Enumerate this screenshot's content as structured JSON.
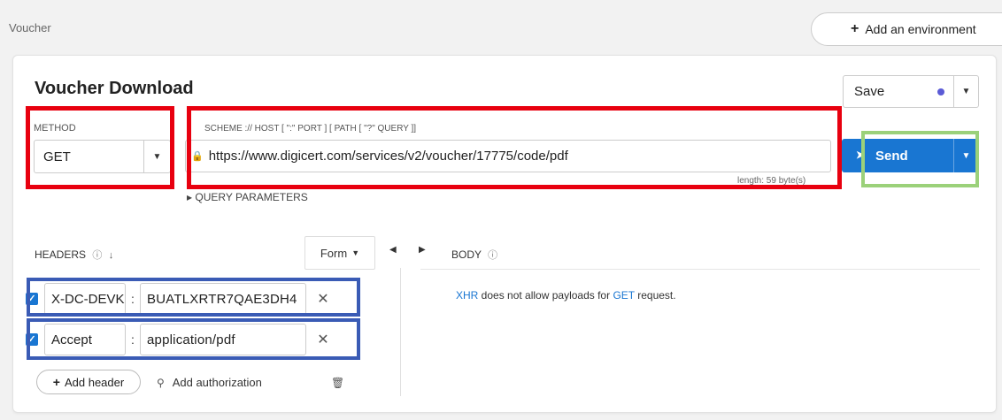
{
  "breadcrumb": "Voucher",
  "add_environment": {
    "label": "Add an environment",
    "icon": "plus-icon"
  },
  "request": {
    "title": "Voucher Download",
    "save_label": "Save",
    "method_label": "METHOD",
    "method_value": "GET",
    "url_label": "SCHEME :// HOST [ \":\" PORT ] [ PATH [ \"?\" QUERY ]]",
    "url_value": "https://www.digicert.com/services/v2/voucher/17775/code/pdf",
    "length_text": "length: 59 byte(s)",
    "query_label": "QUERY PARAMETERS",
    "send_label": "Send"
  },
  "headers": {
    "label": "HEADERS",
    "form_label": "Form",
    "items": [
      {
        "name": "X-DC-DEVKEY",
        "value": "BUATLXRTR7QAE3DH4",
        "checked": true
      },
      {
        "name": "Accept",
        "value": "application/pdf",
        "checked": true
      }
    ],
    "add_header_label": "Add header",
    "add_auth_label": "Add authorization"
  },
  "body": {
    "label": "BODY",
    "msg_xhr": "XHR",
    "msg_mid": " does not allow payloads for ",
    "msg_get": "GET",
    "msg_end": " request."
  },
  "colors": {
    "accent": "#1976d2",
    "annotation_red": "#e8000f",
    "annotation_green": "#9bd17a",
    "annotation_blue": "#3a5bb5"
  }
}
